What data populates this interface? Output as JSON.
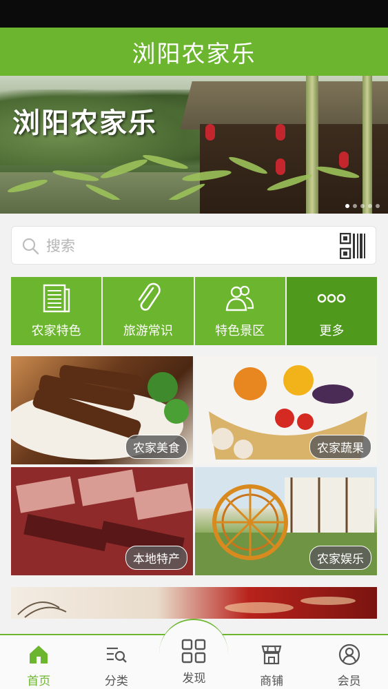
{
  "header": {
    "title": "浏阳农家乐"
  },
  "banner": {
    "text": "浏阳农家乐",
    "page_count": 5,
    "active_page": 1
  },
  "search": {
    "placeholder": "搜索",
    "search_icon": "search-icon",
    "scan_icon": "qr-code-icon"
  },
  "quick_nav": {
    "items": [
      {
        "label": "农家特色",
        "icon": "newspaper-icon"
      },
      {
        "label": "旅游常识",
        "icon": "paperclip-icon"
      },
      {
        "label": "特色景区",
        "icon": "users-icon"
      },
      {
        "label": "更多",
        "icon": "more-dots-icon"
      }
    ]
  },
  "tiles": [
    {
      "label": "农家美食"
    },
    {
      "label": "农家蔬果"
    },
    {
      "label": "本地特产"
    },
    {
      "label": "农家娱乐"
    }
  ],
  "tab_bar": {
    "items": [
      {
        "label": "首页",
        "icon": "home-icon",
        "active": true
      },
      {
        "label": "分类",
        "icon": "category-list-icon",
        "active": false
      },
      {
        "label": "发现",
        "icon": "grid-icon",
        "active": false
      },
      {
        "label": "商铺",
        "icon": "shop-icon",
        "active": false
      },
      {
        "label": "会员",
        "icon": "user-icon",
        "active": false
      }
    ]
  },
  "colors": {
    "brand_green": "#6cb52e",
    "brand_green_dark": "#4f9a1c",
    "status_bar": "#0b0b0b"
  }
}
